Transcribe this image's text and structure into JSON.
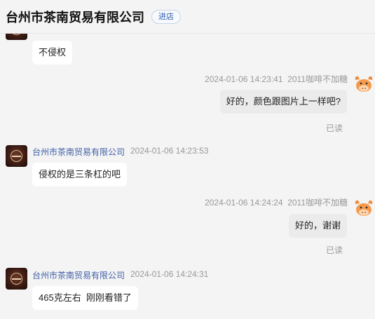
{
  "header": {
    "title": "台州市茶南贸易有限公司",
    "enter_label": "进店"
  },
  "messages": [
    {
      "sender": "shop",
      "text": "不侵权"
    },
    {
      "sender": "me",
      "name": "2011咖啡不加糖",
      "time": "2024-01-06 14:23:41",
      "text": "好的，颜色跟图片上一样吧?",
      "status": "已读"
    },
    {
      "sender": "shop",
      "name": "台州市茶南贸易有限公司",
      "time": "2024-01-06 14:23:53",
      "text": "侵权的是三条杠的吧"
    },
    {
      "sender": "me",
      "name": "2011咖啡不加糖",
      "time": "2024-01-06 14:24:24",
      "text": "好的，谢谢",
      "status": "已读"
    },
    {
      "sender": "shop",
      "name": "台州市茶南贸易有限公司",
      "time": "2024-01-06 14:24:31",
      "text": "465克左右  刚刚看错了"
    }
  ],
  "colors": {
    "shop_name": "#3f5fa8",
    "shop_bubble": "#ffffff",
    "my_bubble": "#ebebeb",
    "meta": "#999999",
    "enter_button": "#2a5db0"
  },
  "icons": {
    "shop_avatar": "shop-logo-avatar",
    "user_avatar": "cartoon-bull-avatar"
  }
}
